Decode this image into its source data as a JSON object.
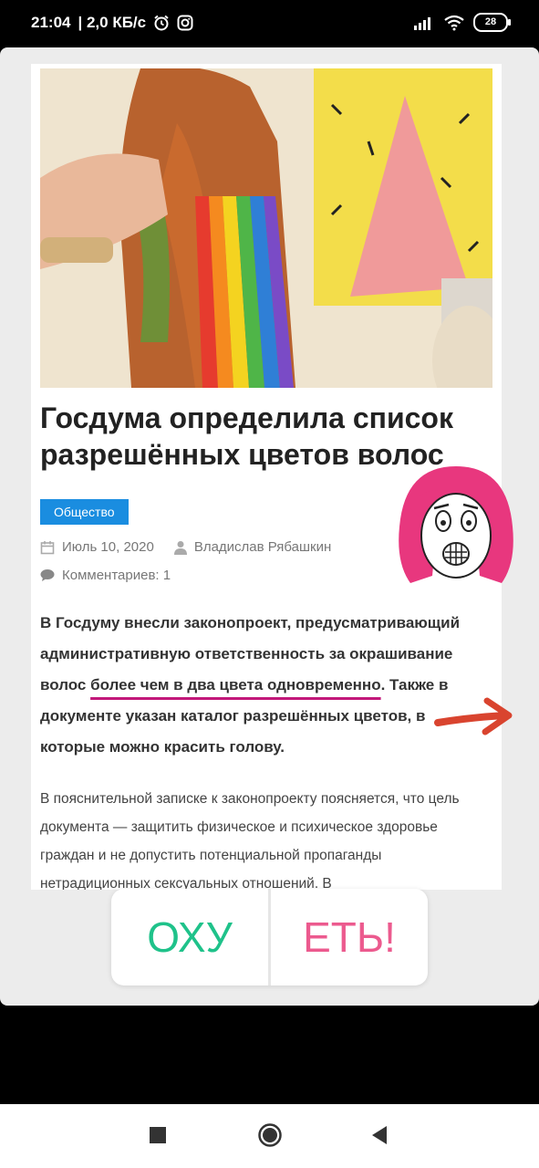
{
  "status_bar": {
    "time": "21:04",
    "speed": "| 2,0 КБ/с",
    "battery": "28",
    "icons": [
      "alarm-icon",
      "instagram-icon",
      "signal-icon",
      "wifi-icon",
      "battery-icon"
    ]
  },
  "article": {
    "headline": "Госдума определила список разрешённых цветов волос",
    "category": "Общество",
    "date": "Июль 10, 2020",
    "author": "Владислав Рябашкин",
    "comments": "Комментариев: 1",
    "lead_part1": "В Госдуму внесли законопроект, предусматривающий административную ответственность за окрашивание волос ",
    "lead_highlight": "более чем в два цвета одновременно",
    "lead_part2": ". Также в документе указан каталог разрешённых цветов, в которые можно красить голову.",
    "body": "В пояснительной записке к законопроекту поясняется, что цель документа — защитить физическое и психическое здоровье граждан и не допустить потенциальной пропаганды нетрадиционных сексуальных отношений. В"
  },
  "poll": {
    "option_1": "ОХУ",
    "option_2": "ЕТЬ!"
  },
  "colors": {
    "category_badge": "#1a8de0",
    "poll_option_1": "#1fc28a",
    "poll_option_2": "#ec5a8e",
    "underline": "#c2187a",
    "arrow": "#d9442f"
  }
}
